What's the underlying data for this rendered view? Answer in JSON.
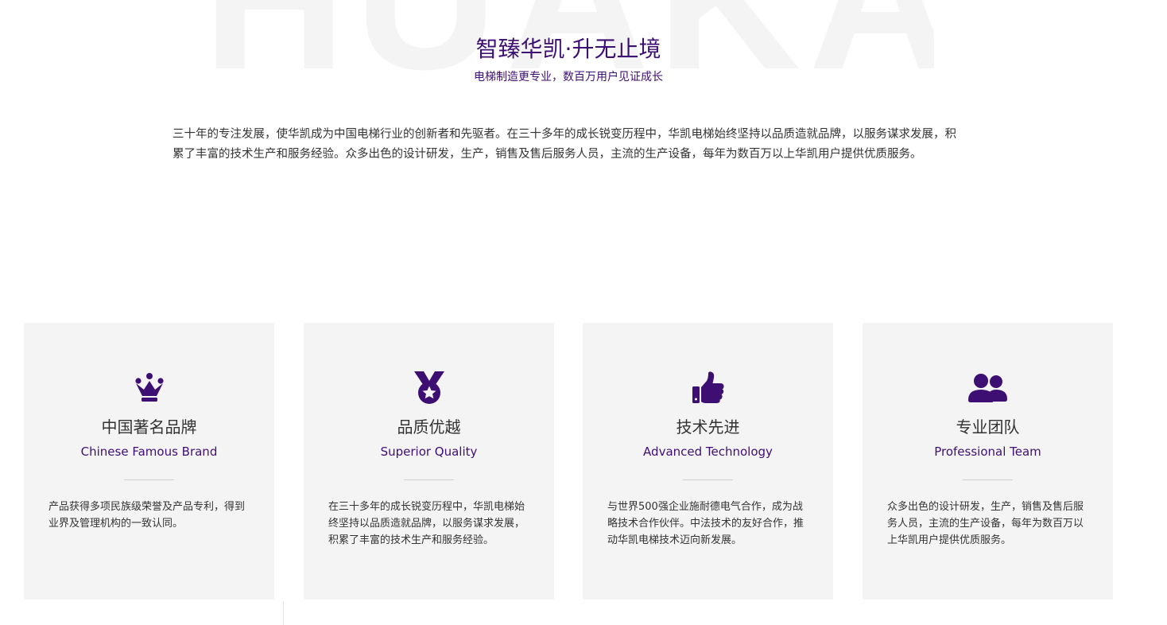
{
  "watermark": "HUAKA",
  "hero": {
    "title": "智臻华凯·升无止境",
    "subtitle": "电梯制造更专业，数百万用户见证成长"
  },
  "intro": "三十年的专注发展，使华凯成为中国电梯行业的创新者和先驱者。在三十多年的成长锐变历程中，华凯电梯始终坚持以品质造就品牌，以服务谋求发展，积累了丰富的技术生产和服务经验。众多出色的设计研发，生产，销售及售后服务人员，主流的生产设备，每年为数百万以上华凯用户提供优质服务。",
  "colors": {
    "accent": "#3e0f72",
    "card_bg": "#f4f4f4",
    "text": "#333333"
  },
  "features": [
    {
      "icon": "crown-icon",
      "title": "中国著名品牌",
      "subtitle": "Chinese Famous Brand",
      "desc": "产品获得多项民族级荣誉及产品专利，得到业界及管理机构的一致认同。"
    },
    {
      "icon": "medal-icon",
      "title": "品质优越",
      "subtitle": "Superior Quality",
      "desc": "在三十多年的成长锐变历程中，华凯电梯始终坚持以品质造就品牌，以服务谋求发展，积累了丰富的技术生产和服务经验。"
    },
    {
      "icon": "thumbs-up-icon",
      "title": "技术先进",
      "subtitle": "Advanced Technology",
      "desc": "与世界500强企业施耐德电气合作，成为战略技术合作伙伴。中法技术的友好合作，推动华凯电梯技术迈向新发展。"
    },
    {
      "icon": "users-icon",
      "title": "专业团队",
      "subtitle": "Professional Team",
      "desc": "众多出色的设计研发，生产，销售及售后服务人员，主流的生产设备，每年为数百万以上华凯用户提供优质服务。"
    }
  ]
}
